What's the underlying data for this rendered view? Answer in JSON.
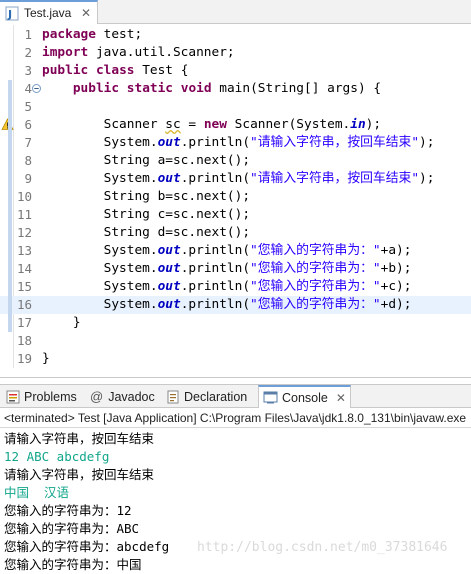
{
  "editor_tab": {
    "title": "Test.java",
    "close": "✕"
  },
  "code_lines": [
    {
      "n": "1",
      "parts": [
        [
          "kw",
          "package"
        ],
        [
          "txt",
          " test;"
        ]
      ]
    },
    {
      "n": "2",
      "parts": [
        [
          "kw",
          "import"
        ],
        [
          "txt",
          " java.util.Scanner;"
        ]
      ]
    },
    {
      "n": "3",
      "parts": [
        [
          "kw",
          "public"
        ],
        [
          "txt",
          " "
        ],
        [
          "kw",
          "class"
        ],
        [
          "txt",
          " Test {"
        ]
      ]
    },
    {
      "n": "4",
      "parts": [
        [
          "txt",
          "    "
        ],
        [
          "kw",
          "public"
        ],
        [
          "txt",
          " "
        ],
        [
          "kw",
          "static"
        ],
        [
          "txt",
          " "
        ],
        [
          "kw",
          "void"
        ],
        [
          "txt",
          " main(String[] args) {"
        ]
      ]
    },
    {
      "n": "5",
      "parts": []
    },
    {
      "n": "6",
      "parts": [
        [
          "txt",
          "        Scanner "
        ],
        [
          "warnvar",
          "sc"
        ],
        [
          "txt",
          " = "
        ],
        [
          "kw",
          "new"
        ],
        [
          "txt",
          " Scanner(System."
        ],
        [
          "fld",
          "in"
        ],
        [
          "txt",
          ");"
        ]
      ]
    },
    {
      "n": "7",
      "parts": [
        [
          "txt",
          "        System."
        ],
        [
          "fld",
          "out"
        ],
        [
          "txt",
          ".println("
        ],
        [
          "str",
          "\"请输入字符串，按回车结束\""
        ],
        [
          "txt",
          ");"
        ]
      ]
    },
    {
      "n": "8",
      "parts": [
        [
          "txt",
          "        String a=sc.next();"
        ]
      ]
    },
    {
      "n": "9",
      "parts": [
        [
          "txt",
          "        System."
        ],
        [
          "fld",
          "out"
        ],
        [
          "txt",
          ".println("
        ],
        [
          "str",
          "\"请输入字符串，按回车结束\""
        ],
        [
          "txt",
          ");"
        ]
      ]
    },
    {
      "n": "10",
      "parts": [
        [
          "txt",
          "        String b=sc.next();"
        ]
      ]
    },
    {
      "n": "11",
      "parts": [
        [
          "txt",
          "        String c=sc.next();"
        ]
      ]
    },
    {
      "n": "12",
      "parts": [
        [
          "txt",
          "        String d=sc.next();"
        ]
      ]
    },
    {
      "n": "13",
      "parts": [
        [
          "txt",
          "        System."
        ],
        [
          "fld",
          "out"
        ],
        [
          "txt",
          ".println("
        ],
        [
          "str",
          "\"您输入的字符串为：\""
        ],
        [
          "txt",
          "+a);"
        ]
      ]
    },
    {
      "n": "14",
      "parts": [
        [
          "txt",
          "        System."
        ],
        [
          "fld",
          "out"
        ],
        [
          "txt",
          ".println("
        ],
        [
          "str",
          "\"您输入的字符串为：\""
        ],
        [
          "txt",
          "+b);"
        ]
      ]
    },
    {
      "n": "15",
      "parts": [
        [
          "txt",
          "        System."
        ],
        [
          "fld",
          "out"
        ],
        [
          "txt",
          ".println("
        ],
        [
          "str",
          "\"您输入的字符串为：\""
        ],
        [
          "txt",
          "+c);"
        ]
      ]
    },
    {
      "n": "16",
      "parts": [
        [
          "txt",
          "        System."
        ],
        [
          "fld",
          "out"
        ],
        [
          "txt",
          ".println("
        ],
        [
          "str",
          "\"您输入的字符串为：\""
        ],
        [
          "txt",
          "+d);"
        ]
      ]
    },
    {
      "n": "17",
      "parts": [
        [
          "txt",
          "    }"
        ]
      ]
    },
    {
      "n": "18",
      "parts": []
    },
    {
      "n": "19",
      "parts": [
        [
          "txt",
          "}"
        ]
      ]
    }
  ],
  "view_tabs": {
    "problems": "Problems",
    "javadoc": "Javadoc",
    "declaration": "Declaration",
    "console": "Console",
    "console_close": "✕"
  },
  "console": {
    "header": "<terminated> Test [Java Application] C:\\Program Files\\Java\\jdk1.8.0_131\\bin\\javaw.exe",
    "lines": [
      {
        "kind": "out",
        "text": "请输入字符串，按回车结束"
      },
      {
        "kind": "in",
        "text": "12 ABC abcdefg"
      },
      {
        "kind": "out",
        "text": "请输入字符串，按回车结束"
      },
      {
        "kind": "in",
        "text": "中国  汉语"
      },
      {
        "kind": "out",
        "text": "您输入的字符串为：12"
      },
      {
        "kind": "out",
        "text": "您输入的字符串为：ABC"
      },
      {
        "kind": "out",
        "text": "您输入的字符串为：abcdefg"
      },
      {
        "kind": "out",
        "text": "您输入的字符串为：中国"
      }
    ],
    "watermark": "http://blog.csdn.net/m0_37381646"
  },
  "colors": {
    "keyword": "#7f0055",
    "field": "#0000c0",
    "string": "#2a00ff",
    "console_input": "#12a68c",
    "current_line": "#e8f2fe"
  }
}
